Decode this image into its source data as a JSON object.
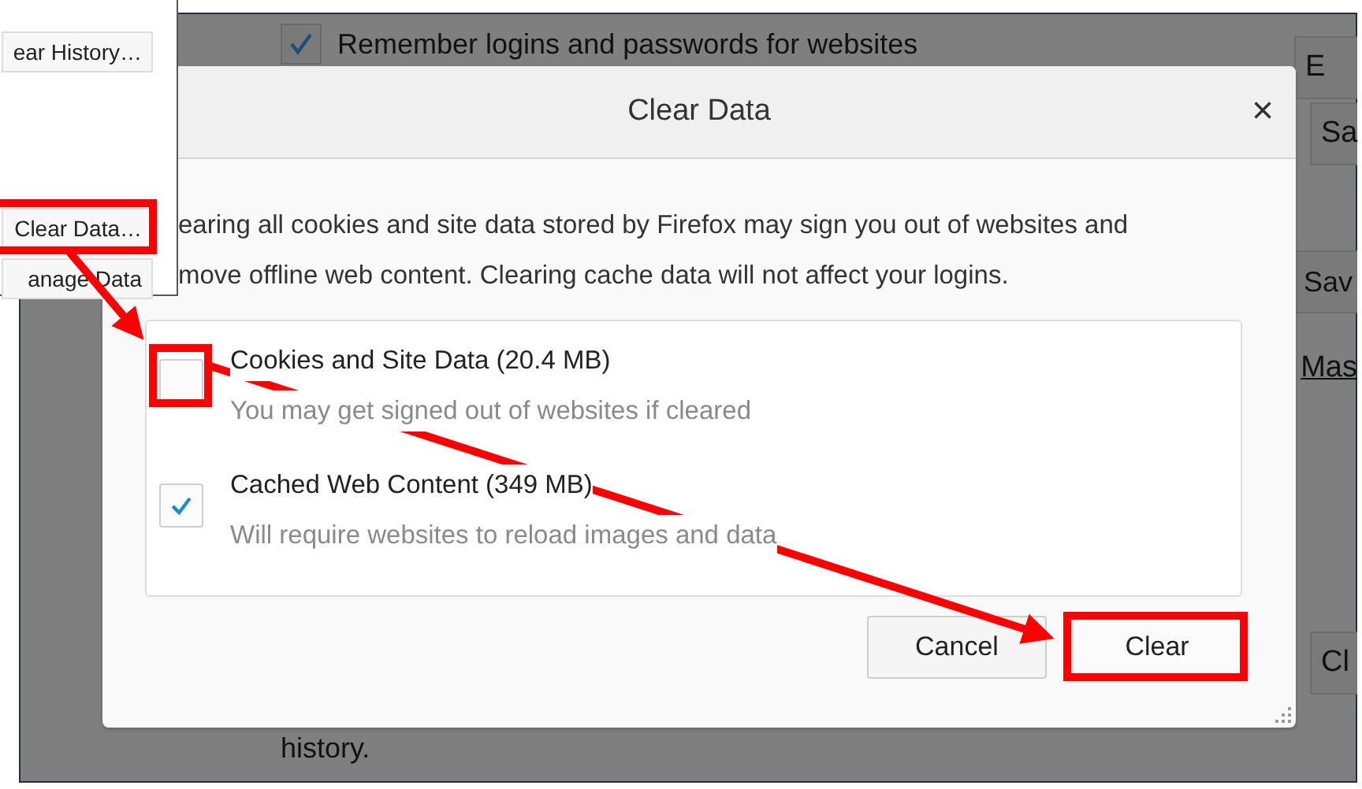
{
  "background": {
    "remember_logins": {
      "label": "Remember logins and passwords for websites",
      "checked": true
    },
    "right_buttons": [
      "E",
      "Sa",
      "Sav"
    ],
    "link": "Mas",
    "lower_button": "Cl",
    "footer_text": "history."
  },
  "inset": {
    "buttons": [
      "ear History…",
      "Clear Data…",
      "anage Data"
    ]
  },
  "dialog": {
    "title": "Clear Data",
    "close": "×",
    "description": [
      "earing all cookies and site data stored by Firefox may sign you out of websites and",
      "move offline web content. Clearing cache data will not affect your logins."
    ],
    "options": [
      {
        "label": "Cookies and Site Data (20.4 MB)",
        "hint": "You may get signed out of websites if cleared",
        "checked": false
      },
      {
        "label": "Cached Web Content (349 MB)",
        "hint": "Will require websites to reload images and data",
        "checked": true
      }
    ],
    "buttons": [
      {
        "label": "Cancel",
        "kind": "secondary"
      },
      {
        "label": "Clear",
        "kind": "primary"
      }
    ]
  }
}
